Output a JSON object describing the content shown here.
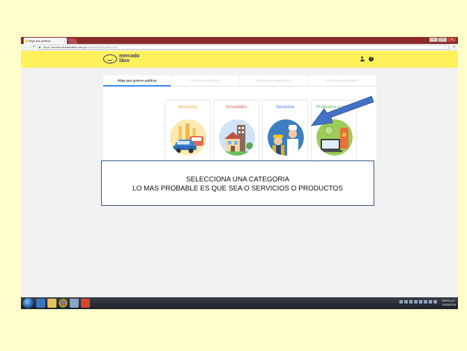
{
  "browser": {
    "tab_title": "Elige qué publicar",
    "tab_close": "×",
    "url_secure": "https://",
    "url_domain": "vender.mercadolibre.com.pe",
    "url_path": "/sell/sell?execution=e1s1",
    "window_controls": [
      "–",
      "□",
      "×"
    ]
  },
  "header": {
    "logo_line1": "mercado",
    "logo_line2": "libre",
    "help_label": "?"
  },
  "steps": [
    {
      "label": "Elige qué quieres publicar",
      "active": true
    },
    {
      "label": "Describe tu producto",
      "active": false
    },
    {
      "label": "Elige precio y exposición",
      "active": false
    },
    {
      "label": "Confirma tu publicación",
      "active": false
    }
  ],
  "categories": [
    {
      "label": "Vehículos",
      "color": "#e8a33a"
    },
    {
      "label": "Inmuebles",
      "color": "#e05a4f"
    },
    {
      "label": "Servicios",
      "color": "#3a7bd5"
    },
    {
      "label": "Productos y otros",
      "color": "#4caf50"
    }
  ],
  "annotation": {
    "line1": "SELECCIONA UNA CATEGORIA",
    "line2": "LO MAS PROBABLE ES QUE SEA O SERVICIOS O PRODUCTOS"
  },
  "taskbar": {
    "time": "06:04 p.m.",
    "date": "23/05/2015"
  },
  "colors": {
    "slide_background": "#ffffcc",
    "ml_yellow": "#fff159",
    "arrow_blue": "#4472c4",
    "annotation_border": "#2f4f7f"
  }
}
